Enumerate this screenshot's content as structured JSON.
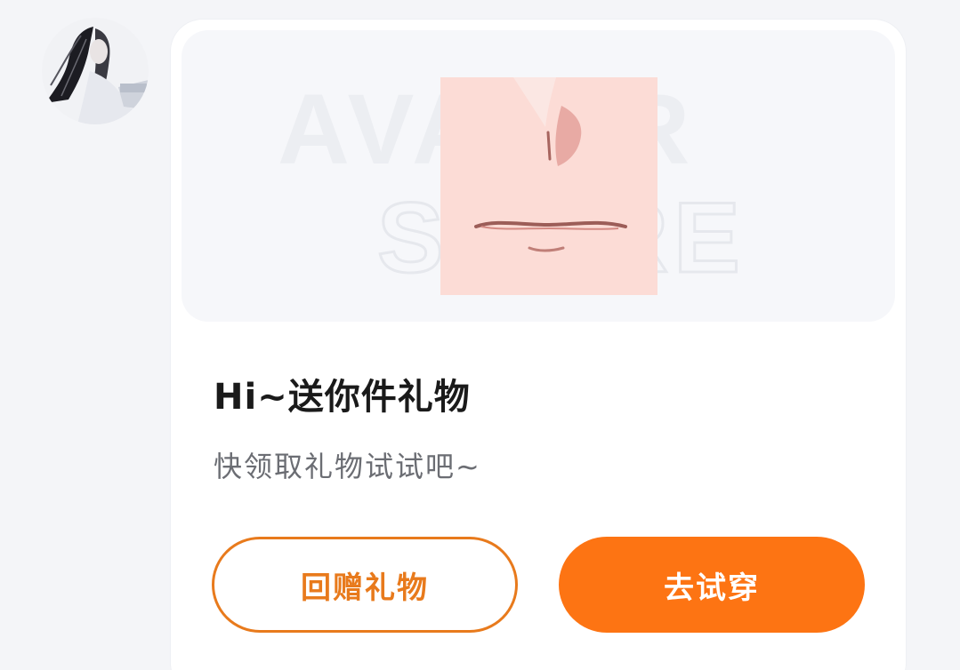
{
  "avatar": {
    "icon": "user-avatar"
  },
  "gift_card": {
    "preview": {
      "watermark": [
        "AVATAR",
        "STORE"
      ],
      "item_icon": "face-makeup-item"
    },
    "title": "Hi~送你件礼物",
    "subtitle": "快领取礼物试试吧~",
    "return_gift_label": "回赠礼物",
    "try_on_label": "去试穿"
  },
  "colors": {
    "accent": "#fd7413",
    "outline": "#e87a1c",
    "thumb_bg": "#fcdcd6",
    "title": "#1a1a1a",
    "subtitle": "#6b6d73"
  }
}
